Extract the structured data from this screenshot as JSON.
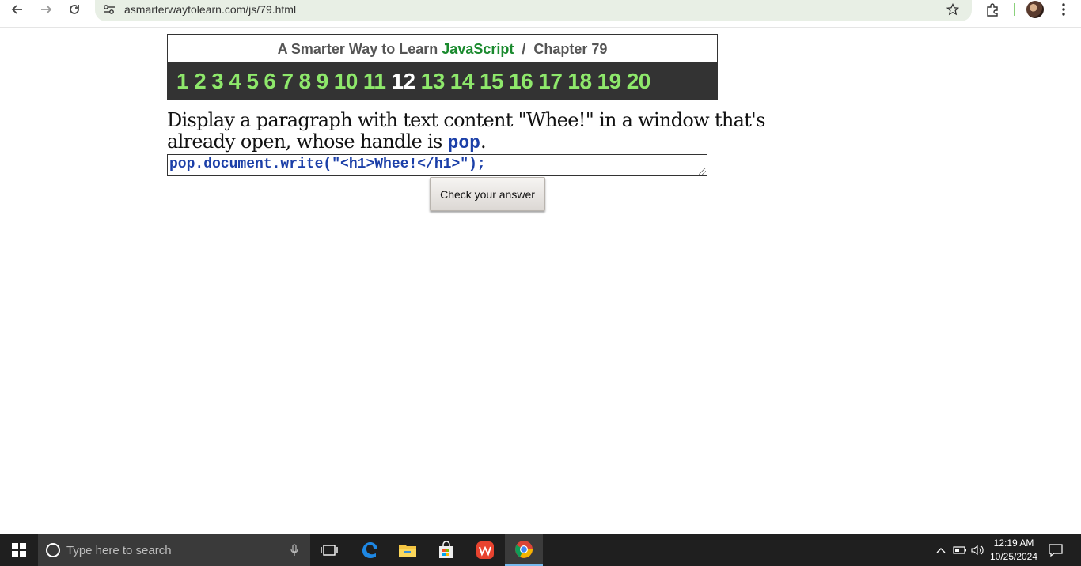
{
  "browser": {
    "url": "asmarterwaytolearn.com/js/79.html"
  },
  "page": {
    "header": {
      "prefix": "A Smarter Way to Learn ",
      "brand": "JavaScript",
      "separator": "  /  ",
      "chapter": "Chapter 79"
    },
    "exercises": [
      "1",
      "2",
      "3",
      "4",
      "5",
      "6",
      "7",
      "8",
      "9",
      "10",
      "11",
      "12",
      "13",
      "14",
      "15",
      "16",
      "17",
      "18",
      "19",
      "20"
    ],
    "current_exercise": "12",
    "question": {
      "text_before": "Display a paragraph with text content \"Whee!\" in a window that's already open, whose handle is ",
      "code": "pop",
      "text_after": "."
    },
    "answer": "pop.document.write(\"<h1>Whee!</h1>\");",
    "check_button": "Check your answer"
  },
  "taskbar": {
    "search_placeholder": "Type here to search",
    "time": "12:19 AM",
    "date": "10/25/2024",
    "apps": [
      "task-view",
      "edge",
      "file-explorer",
      "microsoft-store",
      "wps-office",
      "chrome"
    ]
  },
  "colors": {
    "brand_green": "#1a8a2e",
    "nav_green": "#8ee86b",
    "nav_bg": "#333333",
    "code_blue": "#1b3fa8"
  }
}
